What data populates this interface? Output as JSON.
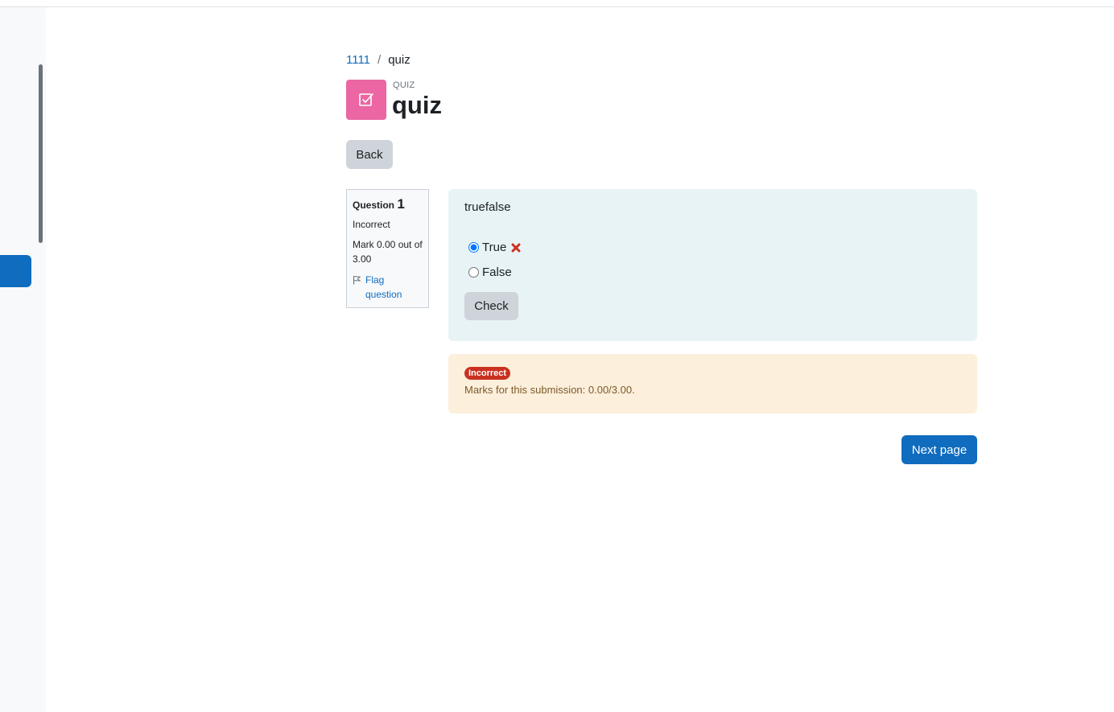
{
  "breadcrumb": {
    "course": "1111",
    "separator": "/",
    "current": "quiz"
  },
  "header": {
    "activity_type": "QUIZ",
    "title": "quiz",
    "icon": "quiz-checkbox-icon",
    "icon_color": "#eb66a2"
  },
  "back_label": "Back",
  "question_info": {
    "label": "Question",
    "number": "1",
    "state": "Incorrect",
    "grade": "Mark 0.00 out of 3.00",
    "flag_label": "Flag question",
    "flag_icon": "flag-icon"
  },
  "question": {
    "text": "truefalse",
    "answers": [
      {
        "label": "True",
        "selected": true,
        "marked_wrong": true
      },
      {
        "label": "False",
        "selected": false,
        "marked_wrong": false
      }
    ],
    "check_label": "Check"
  },
  "feedback": {
    "badge": "Incorrect",
    "marks": "Marks for this submission: 0.00/3.00."
  },
  "next_label": "Next page",
  "colors": {
    "primary": "#0f6cbf",
    "incorrect": "#ca3120",
    "formulation_bg": "#e7f3f5",
    "feedback_bg": "#fcefdc"
  }
}
